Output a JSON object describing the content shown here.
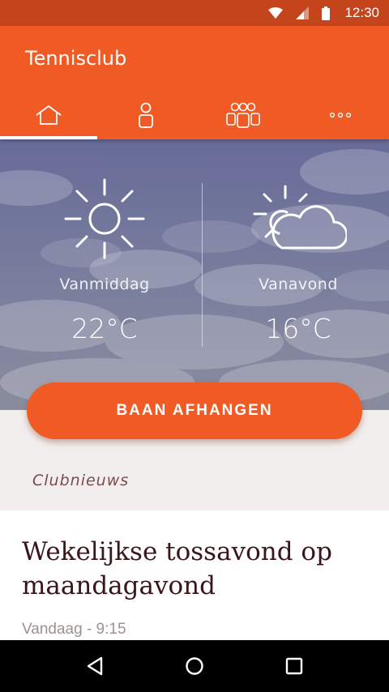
{
  "status_bar": {
    "time": "12:30",
    "icons": [
      "wifi-icon",
      "signal-icon",
      "battery-icon"
    ]
  },
  "app_bar": {
    "title": "Tennisclub",
    "tabs": [
      {
        "icon": "home-icon",
        "active": true
      },
      {
        "icon": "person-icon",
        "active": false
      },
      {
        "icon": "group-icon",
        "active": false
      },
      {
        "icon": "more-icon",
        "active": false
      }
    ]
  },
  "weather": {
    "afternoon": {
      "label": "Vanmiddag",
      "temp": "22°C",
      "icon": "sun-icon"
    },
    "evening": {
      "label": "Vanavond",
      "temp": "16°C",
      "icon": "partly-cloudy-icon"
    }
  },
  "cta": {
    "label": "BAAN AFHANGEN"
  },
  "news": {
    "section_label": "Clubnieuws",
    "items": [
      {
        "title": "Wekelijkse tossavond op maandagavond",
        "meta": "Vandaag - 9:15"
      }
    ]
  },
  "nav_bar": {
    "buttons": [
      "back-icon",
      "home-circle-icon",
      "recents-icon"
    ]
  },
  "colors": {
    "accent": "#f05a24",
    "status_bar": "#c4441b",
    "title_text": "#3a1618",
    "section_text": "#7b4b4b"
  }
}
